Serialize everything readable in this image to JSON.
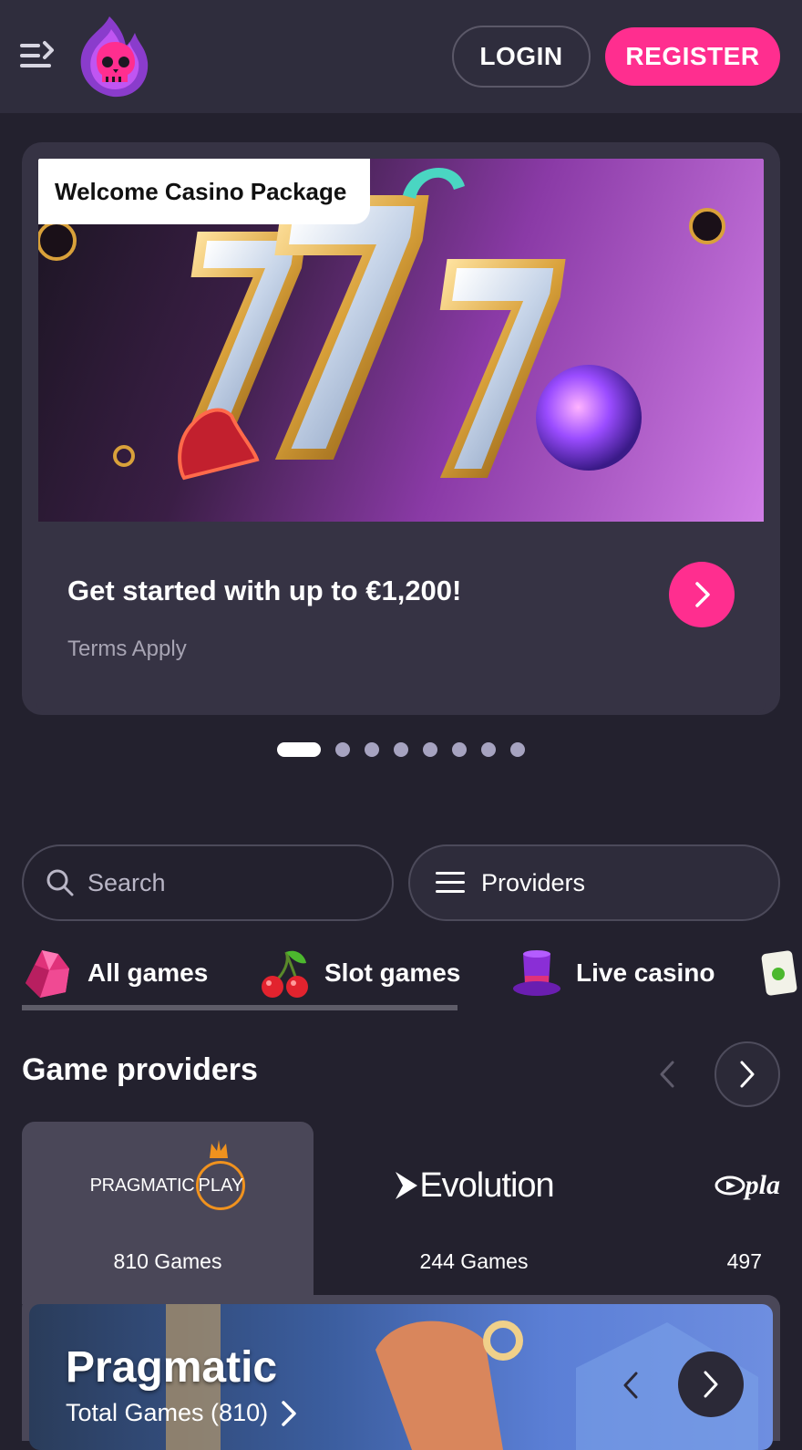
{
  "header": {
    "login_label": "LOGIN",
    "register_label": "REGISTER"
  },
  "promo": {
    "tag": "Welcome Casino Package",
    "title": "Get started with up to €1,200!",
    "terms": "Terms Apply",
    "slide_count": 8,
    "active_slide": 1
  },
  "search": {
    "placeholder": "Search"
  },
  "providers_button": {
    "label": "Providers"
  },
  "categories": [
    {
      "label": "All games",
      "icon": "gem-icon"
    },
    {
      "label": "Slot games",
      "icon": "cherry-icon"
    },
    {
      "label": "Live casino",
      "icon": "top-hat-icon"
    }
  ],
  "game_providers": {
    "title": "Game providers",
    "items": [
      {
        "name": "PRAGMATIC PLAY",
        "logo_text_a": "PRAGMATIC",
        "logo_text_b": "PLAY",
        "games": "810 Games"
      },
      {
        "name": "Evolution",
        "logo_text_a": "Evolution",
        "games": "244 Games"
      },
      {
        "name": "play",
        "logo_text_a": "pla",
        "games": "497"
      }
    ]
  },
  "featured": {
    "name": "Pragmatic",
    "total": "Total Games (810)"
  },
  "colors": {
    "accent": "#ff2e8f",
    "background": "#23212e",
    "header": "#2f2d3d",
    "card": "#363344"
  }
}
